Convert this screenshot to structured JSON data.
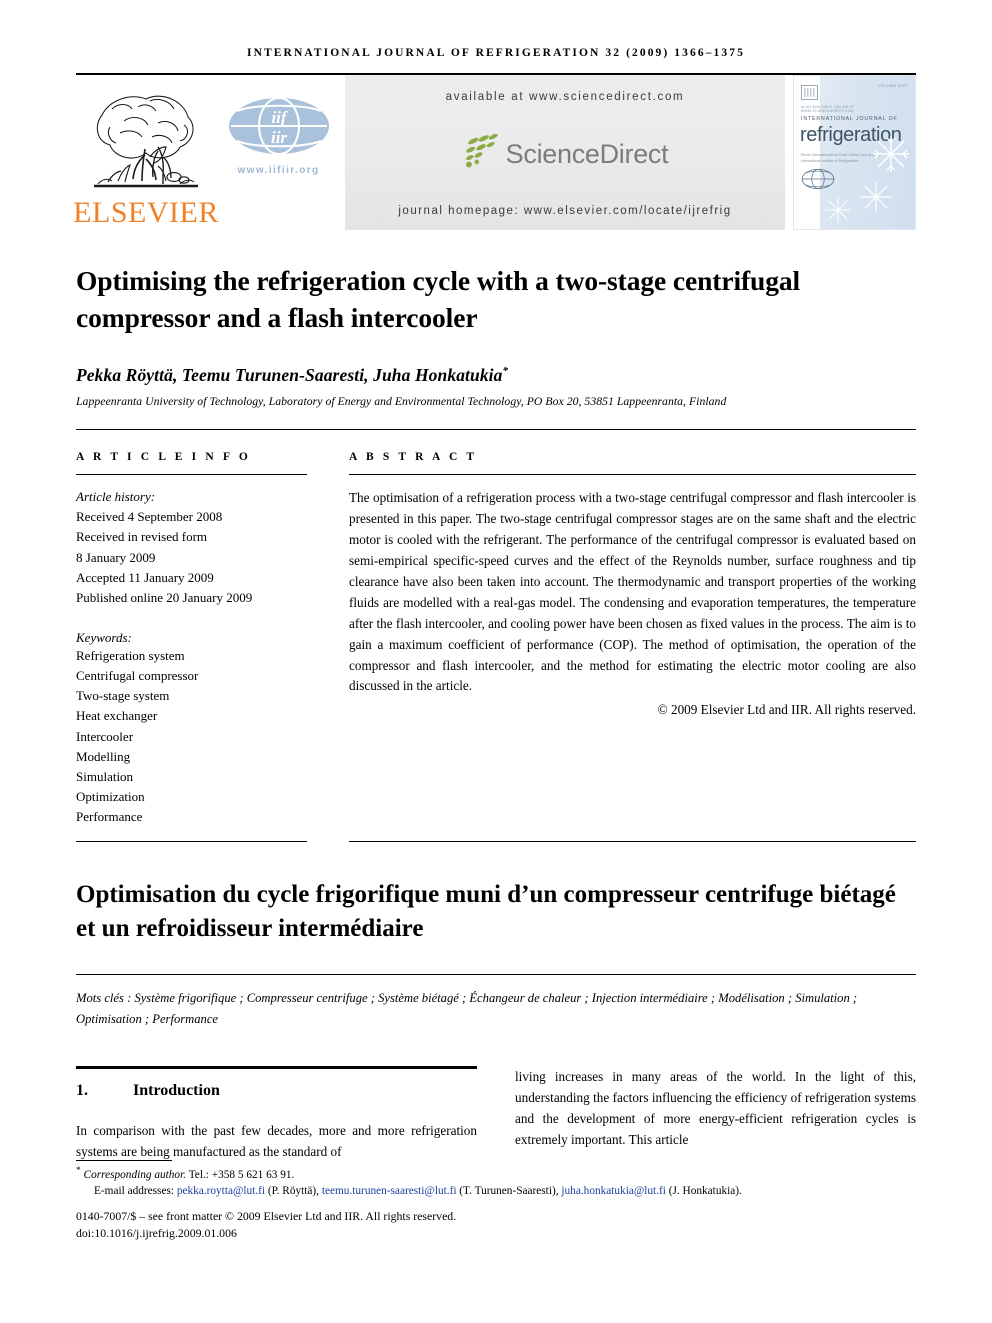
{
  "running_head": "International Journal of Refrigeration 32 (2009) 1366–1375",
  "masthead": {
    "elsevier_wordmark": "ELSEVIER",
    "iifiir_url": "www.iifiir.org",
    "sciencedirect": {
      "available_at": "available at www.sciencedirect.com",
      "logo_text": "ScienceDirect",
      "journal_homepage": "journal homepage: www.elsevier.com/locate/ijrefrig"
    },
    "cover": {
      "volume_label": "VOLUME 2007",
      "publisher_tiny": "ALSO AVAILABLE ONLINE AT WWW.SCIENCEDIRECT.COM",
      "journal_line": "INTERNATIONAL JOURNAL OF",
      "journal_name": "refrigeration",
      "subtitle": "Revue Internationale du Froid\nOfficial Journal of the International Institute of Refrigeration"
    }
  },
  "article": {
    "title": "Optimising the refrigeration cycle with a two-stage centrifugal compressor and a flash intercooler",
    "authors": "Pekka Röyttä, Teemu Turunen-Saaresti, Juha Honkatukia",
    "author_marker": "*",
    "affiliation": "Lappeenranta University of Technology, Laboratory of Energy and Environmental Technology, PO Box 20, 53851 Lappeenranta, Finland"
  },
  "article_info": {
    "heading": "A R T I C L E   I N F O",
    "history_label": "Article history:",
    "history": [
      "Received 4 September 2008",
      "Received in revised form",
      "8 January 2009",
      "Accepted 11 January 2009",
      "Published online 20 January 2009"
    ],
    "keywords_label": "Keywords:",
    "keywords": [
      "Refrigeration system",
      "Centrifugal compressor",
      "Two-stage system",
      "Heat exchanger",
      "Intercooler",
      "Modelling",
      "Simulation",
      "Optimization",
      "Performance"
    ]
  },
  "abstract": {
    "heading": "A B S T R A C T",
    "text": "The optimisation of a refrigeration process with a two-stage centrifugal compressor and flash intercooler is presented in this paper. The two-stage centrifugal compressor stages are on the same shaft and the electric motor is cooled with the refrigerant. The performance of the centrifugal compressor is evaluated based on semi-empirical specific-speed curves and the effect of the Reynolds number, surface roughness and tip clearance have also been taken into account. The thermodynamic and transport properties of the working fluids are modelled with a real-gas model. The condensing and evaporation temperatures, the temperature after the flash intercooler, and cooling power have been chosen as fixed values in the process. The aim is to gain a maximum coefficient of performance (COP). The method of optimisation, the operation of the compressor and flash intercooler, and the method for estimating the electric motor cooling are also discussed in the article.",
    "copyright": "© 2009 Elsevier Ltd and IIR. All rights reserved."
  },
  "french": {
    "title": "Optimisation du cycle frigorifique muni d’un compresseur centrifuge biétagé et un refroidisseur intermédiaire",
    "keywords_label": "Mots clés :",
    "keywords_text": "Système frigorifique ; Compresseur centrifuge ; Système biétagé ; Échangeur de chaleur ; Injection intermédiaire ; Modélisation ; Simulation ; Optimisation ; Performance"
  },
  "body": {
    "section_number": "1.",
    "section_title": "Introduction",
    "column_left": "In comparison with the past few decades, more and more refrigeration systems are being manufactured as the standard of",
    "column_right": "living increases in many areas of the world. In the light of this, understanding the factors influencing the efficiency of refrigeration systems and the development of more energy-efficient refrigeration cycles is extremely important. This article"
  },
  "footnotes": {
    "corresponding_marker": "*",
    "corresponding_label": "Corresponding author.",
    "corresponding_tel": "Tel.: +358 5 621 63 91.",
    "emails_label": "E-mail addresses:",
    "emails": [
      {
        "address": "pekka.roytta@lut.fi",
        "owner": "(P. Röyttä),"
      },
      {
        "address": "teemu.turunen-saaresti@lut.fi",
        "owner": "(T. Turunen-Saaresti),"
      },
      {
        "address": "juha.honkatukia@lut.fi",
        "owner": "(J. Honkatukia)."
      }
    ],
    "issn_line": "0140-7007/$ – see front matter © 2009 Elsevier Ltd and IIR. All rights reserved.",
    "doi_line": "doi:10.1016/j.ijrefrig.2009.01.006"
  },
  "colors": {
    "elsevier_orange": "#F08127",
    "sciencedirect_green": "#7fa53f",
    "sciencedirect_gray": "#7c7c7c",
    "link_blue": "#1a3fa0",
    "iif_blue": "#9DB7D4"
  }
}
